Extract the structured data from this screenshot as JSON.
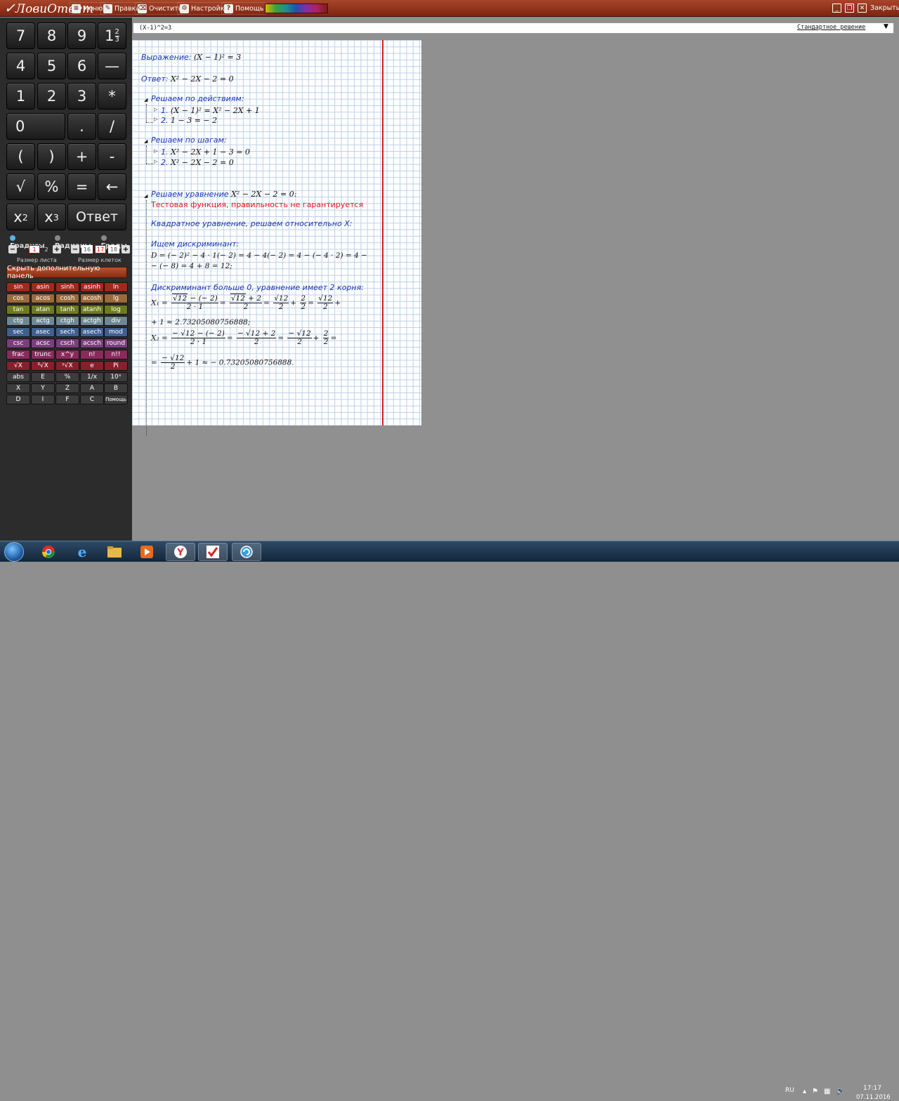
{
  "app": {
    "logo_mark": "✓",
    "logo_text": "ЛовиОтвет"
  },
  "toolbar": {
    "menu": "Меню",
    "edit": "Правка",
    "clear": "Очистить",
    "settings": "Настройки",
    "help": "Помощь",
    "close": "Закрыть"
  },
  "keypad": {
    "k7": "7",
    "k8": "8",
    "k9": "9",
    "mixed_whole": "1",
    "mixed_num": "2",
    "mixed_den": "3",
    "k4": "4",
    "k5": "5",
    "k6": "6",
    "minus_long": "—",
    "k1": "1",
    "k2": "2",
    "k3": "3",
    "mul": "*",
    "k0": "0",
    "dot": ".",
    "div": "/",
    "lpar": "(",
    "rpar": ")",
    "plus": "+",
    "minus": "-",
    "sqrt": "√",
    "percent": "%",
    "equals": "=",
    "backspace": "←",
    "x": "x",
    "sq_exp": "2",
    "cube_exp": "3",
    "answer": "Ответ"
  },
  "angle_modes": {
    "degrees": "Градусы",
    "radians": "Радианы",
    "grads": "Грады",
    "selected": "degrees"
  },
  "sheet_size": {
    "label": "Размер листа",
    "value": "1",
    "next": "2"
  },
  "cell_size": {
    "label": "Размер клеток",
    "prev": "16",
    "value": "17",
    "next": "18"
  },
  "hide_panel_label": "Скрыть дополнительную панель",
  "functions": [
    [
      "sin",
      "asin",
      "sinh",
      "asinh",
      "ln"
    ],
    [
      "cos",
      "acos",
      "cosh",
      "acosh",
      "lg"
    ],
    [
      "tan",
      "atan",
      "tanh",
      "atanh",
      "log"
    ],
    [
      "ctg",
      "actg",
      "ctgh",
      "actgh",
      "div"
    ],
    [
      "sec",
      "asec",
      "sech",
      "asech",
      "mod"
    ],
    [
      "csc",
      "acsc",
      "csch",
      "acsch",
      "round"
    ],
    [
      "frac",
      "trunc",
      "x^y",
      "n!",
      "n!!"
    ],
    [
      "√X",
      "³√X",
      "ʸ√X",
      "e",
      "Pi"
    ],
    [
      "abs",
      "E",
      "%",
      "1/x",
      "10ˣ"
    ],
    [
      "X",
      "Y",
      "Z",
      "A",
      "B"
    ],
    [
      "D",
      "I",
      "F",
      "C",
      "Помощь"
    ]
  ],
  "function_colors": [
    "#a3281c",
    "#9a6a3a",
    "#6f7a1e",
    "#6e8795",
    "#3f5f8f",
    "#7b3e7e",
    "#8a2a5b",
    "#8a1f2c",
    "#3c3c3c",
    "#3c3c3c",
    "#3c3c3c"
  ],
  "input": {
    "expression": "(X-1)^2=3",
    "mode": "Стандартное решение"
  },
  "solution": {
    "expr_label": "Выражение:",
    "expr": "(X − 1)² = 3",
    "answer_label": "Ответ:",
    "answer": "X² − 2X − 2 = 0",
    "actions_title": "Решаем по действиям:",
    "action1_num": "1.",
    "action1": "(X − 1)² = X² − 2X + 1",
    "action2_num": "2.",
    "action2": "1 − 3 = − 2",
    "steps_title": "Решаем по шагам:",
    "step1_num": "1.",
    "step1": "X² − 2X + 1 − 3 = 0",
    "step2_num": "2.",
    "step2": "X² − 2X − 2 = 0",
    "equation_title": "Решаем уравнение",
    "equation": "X² − 2X − 2 = 0:",
    "warning": "Тестовая функция, правильность не гарантируется",
    "quadratic": "Квадратное уравнение, решаем относительно X:",
    "disc_title": "Ищем дискриминант:",
    "disc_line1": "D = (− 2)² − 4 · 1(− 2) = 4 − 4(− 2) = 4 − (− 4 · 2) = 4 −",
    "disc_line2": "− (− 8) = 4 + 8 = 12;",
    "disc_positive": "Дискриминант больше 0, уравнение имеет 2 корня:",
    "x1_label": "X₁ =",
    "x1_f1_num_a": "√12",
    "x1_f1_num_b": " − (− 2)",
    "x1_f1_den": "2 · 1",
    "x1_f2_num_a": "√12",
    "x1_f2_num_b": " + 2",
    "x1_f2_den": "2",
    "x1_f3_num": "√12",
    "x1_f3_den": "2",
    "x1_f4_num": "2",
    "x1_f4_den": "2",
    "x1_f5_num": "√12",
    "x1_f5_den": "2",
    "x1_tail": "+ 1 ≈ 2.73205080756888;",
    "x2_label": "X₂ =",
    "x2_f1_num_a": "− √12",
    "x2_f1_num_b": " − (− 2)",
    "x2_f1_den": "2 · 1",
    "x2_f2_num_a": "− √12",
    "x2_f2_num_b": " + 2",
    "x2_f2_den": "2",
    "x2_f3_num": "− √12",
    "x2_f3_den": "2",
    "x2_f4_num": "2",
    "x2_f4_den": "2",
    "x2_tail_num": "− √12",
    "x2_tail_den": "2",
    "x2_tail": "+ 1 ≈ − 0.73205080756888."
  },
  "taskbar": {
    "lang": "RU",
    "time": "17:17",
    "date": "07.11.2016"
  },
  "colors": {
    "titlebar": "#8f2f17",
    "accent_red": "#e0181c",
    "text_blue": "#1535b8"
  }
}
